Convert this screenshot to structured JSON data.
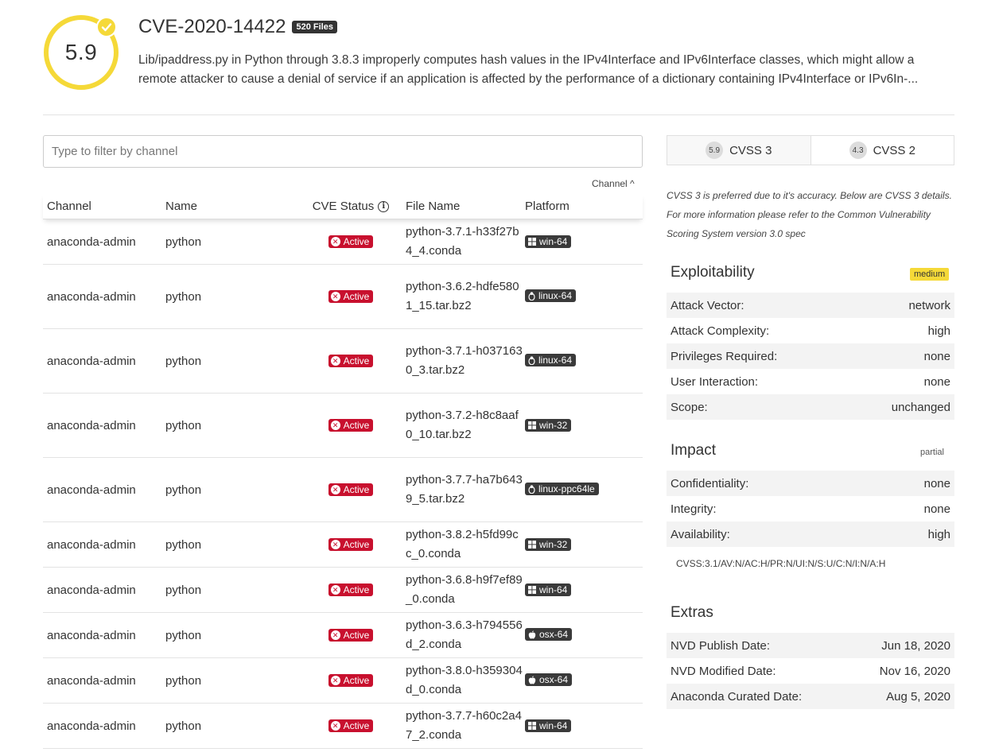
{
  "header": {
    "score": "5.9",
    "cve_id": "CVE-2020-14422",
    "files_badge": "520 Files",
    "description": "Lib/ipaddress.py in Python through 3.8.3 improperly computes hash values in the IPv4Interface and IPv6Interface classes, which might allow a remote attacker to cause a denial of service if an application is affected by the performance of a dictionary containing IPv4Interface or IPv6In-..."
  },
  "filter": {
    "placeholder": "Type to filter by channel"
  },
  "sort_hint": "Channel ^",
  "table": {
    "headers": {
      "channel": "Channel",
      "name": "Name",
      "status": "CVE Status",
      "file": "File Name",
      "platform": "Platform"
    },
    "rows": [
      {
        "channel": "anaconda-admin",
        "name": "python",
        "status": "Active",
        "file": "python-3.7.1-h33f27b4_4.conda",
        "platform": "win-64",
        "os": "windows"
      },
      {
        "channel": "anaconda-admin",
        "name": "python",
        "status": "Active",
        "file": "python-3.6.2-hdfe5801_15.tar.bz2",
        "platform": "linux-64",
        "os": "linux"
      },
      {
        "channel": "anaconda-admin",
        "name": "python",
        "status": "Active",
        "file": "python-3.7.1-h0371630_3.tar.bz2",
        "platform": "linux-64",
        "os": "linux"
      },
      {
        "channel": "anaconda-admin",
        "name": "python",
        "status": "Active",
        "file": "python-3.7.2-h8c8aaf0_10.tar.bz2",
        "platform": "win-32",
        "os": "windows"
      },
      {
        "channel": "anaconda-admin",
        "name": "python",
        "status": "Active",
        "file": "python-3.7.7-ha7b6439_5.tar.bz2",
        "platform": "linux-ppc64le",
        "os": "linux"
      },
      {
        "channel": "anaconda-admin",
        "name": "python",
        "status": "Active",
        "file": "python-3.8.2-h5fd99cc_0.conda",
        "platform": "win-32",
        "os": "windows"
      },
      {
        "channel": "anaconda-admin",
        "name": "python",
        "status": "Active",
        "file": "python-3.6.8-h9f7ef89_0.conda",
        "platform": "win-64",
        "os": "windows"
      },
      {
        "channel": "anaconda-admin",
        "name": "python",
        "status": "Active",
        "file": "python-3.6.3-h794556d_2.conda",
        "platform": "osx-64",
        "os": "apple"
      },
      {
        "channel": "anaconda-admin",
        "name": "python",
        "status": "Active",
        "file": "python-3.8.0-h359304d_0.conda",
        "platform": "osx-64",
        "os": "apple"
      },
      {
        "channel": "anaconda-admin",
        "name": "python",
        "status": "Active",
        "file": "python-3.7.7-h60c2a47_2.conda",
        "platform": "win-64",
        "os": "windows"
      }
    ]
  },
  "tabs": [
    {
      "score": "5.9",
      "label": "CVSS 3"
    },
    {
      "score": "4.3",
      "label": "CVSS 2"
    }
  ],
  "cvss_note": "CVSS 3 is preferred due to it's accuracy. Below are CVSS 3 details. For more information please refer to the Common Vulnerability Scoring System version 3.0 spec",
  "exploitability": {
    "title": "Exploitability",
    "badge": "medium",
    "rows": [
      {
        "label": "Attack Vector:",
        "value": "network"
      },
      {
        "label": "Attack Complexity:",
        "value": "high"
      },
      {
        "label": "Privileges Required:",
        "value": "none"
      },
      {
        "label": "User Interaction:",
        "value": "none"
      },
      {
        "label": "Scope:",
        "value": "unchanged"
      }
    ]
  },
  "impact": {
    "title": "Impact",
    "badge": "partial",
    "rows": [
      {
        "label": "Confidentiality:",
        "value": "none"
      },
      {
        "label": "Integrity:",
        "value": "none"
      },
      {
        "label": "Availability:",
        "value": "high"
      }
    ],
    "vector": "CVSS:3.1/AV:N/AC:H/PR:N/UI:N/S:U/C:N/I:N/A:H"
  },
  "extras": {
    "title": "Extras",
    "rows": [
      {
        "label": "NVD Publish Date:",
        "value": "Jun 18, 2020"
      },
      {
        "label": "NVD Modified Date:",
        "value": "Nov 16, 2020"
      },
      {
        "label": "Anaconda Curated Date:",
        "value": "Aug 5, 2020"
      }
    ]
  },
  "colors": {
    "score_ring": "#f5d938",
    "active_badge": "#c8102e",
    "platform_badge": "#3a3a3a"
  }
}
